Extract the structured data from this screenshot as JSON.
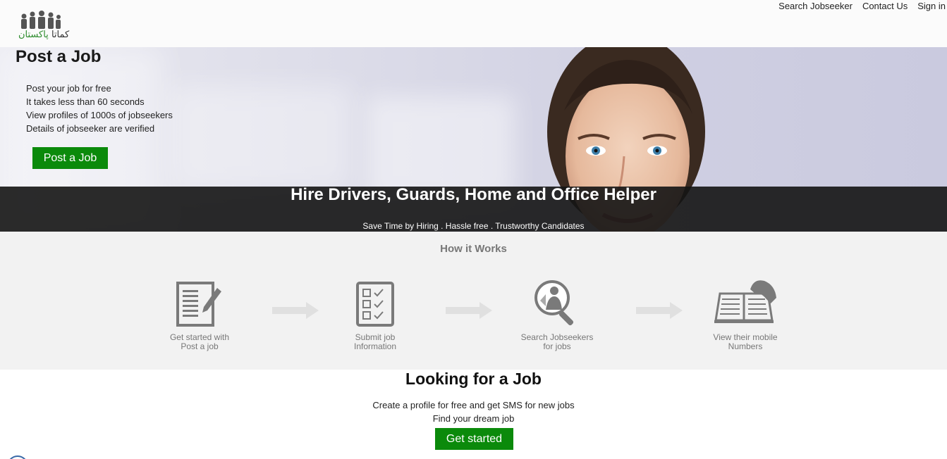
{
  "nav": {
    "search_jobseeker": "Search Jobseeker",
    "contact_us": "Contact Us",
    "sign_in": "Sign in"
  },
  "logo": {
    "urdu_dark": "کماتا",
    "urdu_green": "پاکستان"
  },
  "hero": {
    "title": "Post a Job",
    "points": [
      "Post your job for free",
      "It takes less than 60 seconds",
      "View profiles of 1000s of jobseekers",
      "Details of jobseeker are verified"
    ],
    "button": "Post a Job"
  },
  "banner": {
    "headline": "Hire Drivers, Guards, Home and Office Helper",
    "tagline": "Save Time by Hiring  . Hassle free  . Trustworthy Candidates"
  },
  "how": {
    "title": "How it Works",
    "steps": [
      {
        "line1": "Get started with",
        "line2": "Post a job",
        "icon": "document-pencil-icon"
      },
      {
        "line1": "Submit job",
        "line2": "Information",
        "icon": "checklist-icon"
      },
      {
        "line1": "Search Jobseekers",
        "line2": "for jobs",
        "icon": "magnifier-person-icon"
      },
      {
        "line1": "View their mobile",
        "line2": "Numbers",
        "icon": "phone-book-icon"
      }
    ]
  },
  "looking": {
    "title": "Looking for a Job",
    "line1": "Create a profile for free and get SMS for new jobs",
    "line2": "Find your dream job",
    "button": "Get started"
  },
  "colors": {
    "green": "#0b8a0b",
    "banner": "#141414",
    "section_bg": "#f2f2f2",
    "icon_gray": "#7a7a7a"
  }
}
